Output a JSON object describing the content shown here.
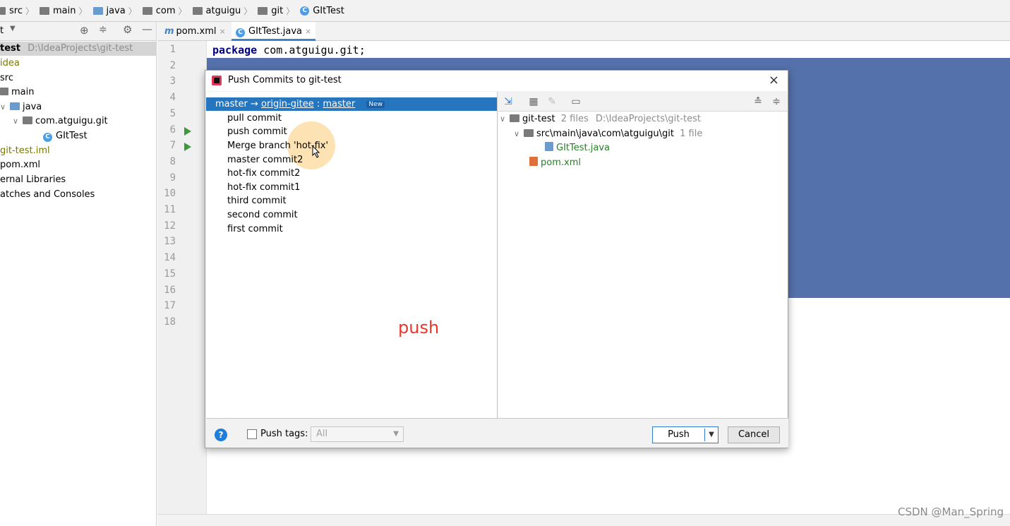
{
  "breadcrumb": {
    "items": [
      "src",
      "main",
      "java",
      "com",
      "atguigu",
      "git",
      "GItTest"
    ]
  },
  "project_panel": {
    "header_label": "t",
    "tree": [
      {
        "label": "test",
        "path": "D:\\IdeaProjects\\git-test"
      },
      {
        "label": "idea"
      },
      {
        "label": "src"
      },
      {
        "label": "main"
      },
      {
        "label": "java"
      },
      {
        "label": "com.atguigu.git"
      },
      {
        "label": "GItTest"
      },
      {
        "label": "git-test.iml"
      },
      {
        "label": "pom.xml"
      },
      {
        "label": "ernal Libraries"
      },
      {
        "label": "atches and Consoles"
      }
    ]
  },
  "tabs": [
    {
      "label": "pom.xml",
      "icon": "maven-icon",
      "close": "×"
    },
    {
      "label": "GItTest.java",
      "icon": "class-icon",
      "close": "×"
    }
  ],
  "editor": {
    "line_numbers": [
      "1",
      "2",
      "3",
      "4",
      "5",
      "6",
      "7",
      "8",
      "9",
      "10",
      "11",
      "12",
      "13",
      "14",
      "15",
      "16",
      "17",
      "18"
    ],
    "code_line1_keyword": "package",
    "code_line1_rest": " com.atguigu.git;"
  },
  "dialog": {
    "title": "Push Commits to git-test",
    "close": "×",
    "branch": {
      "local": "master",
      "arrow": "→",
      "remote": "origin-gitee",
      "colon": ":",
      "remote_branch": "master",
      "badge": "New"
    },
    "commits": [
      "pull commit",
      "push commit",
      "Merge branch 'hot-fix'",
      "master commit2",
      "hot-fix commit2",
      "hot-fix commit1",
      "third commit",
      "second commit",
      "first commit"
    ],
    "annotation": "push",
    "files": {
      "root": {
        "label": "git-test",
        "count": "2 files",
        "path": "D:\\IdeaProjects\\git-test"
      },
      "folder": {
        "label": "src\\main\\java\\com\\atguigu\\git",
        "count": "1 file"
      },
      "file1": "GItTest.java",
      "file2": "pom.xml"
    },
    "bottom": {
      "help": "?",
      "push_tags_label": "Push tags:",
      "tags_value": "All",
      "push_button": "Push",
      "cancel_button": "Cancel"
    }
  },
  "watermark": "CSDN @Man_Spring",
  "colors": {
    "selection_blue": "#2675bf",
    "editor_selection": "#5471ab",
    "annotation_red": "#e8372b"
  }
}
